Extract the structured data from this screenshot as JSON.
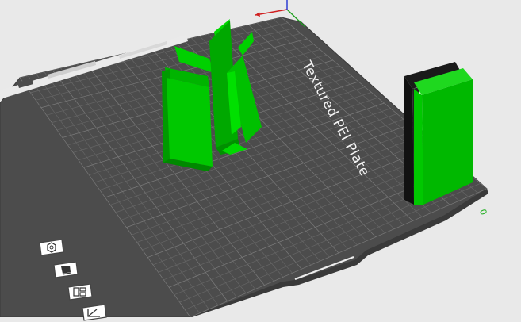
{
  "viewport": {
    "plate_label": "Textured PEI Plate",
    "origin_label": "0"
  },
  "colors": {
    "background": "#e9e9e9",
    "plate": "#4c4c4c",
    "grid": "#6a6a6a",
    "model_green": "#00c800",
    "model_green_dark": "#009a00",
    "model_black": "#1a1a1a",
    "axis_x": "#d02020",
    "axis_y": "#20a020",
    "axis_z": "#2030d0"
  },
  "toolbar_icons": [
    {
      "name": "nut-icon"
    },
    {
      "name": "bed-type-icon"
    },
    {
      "name": "layout-icon"
    },
    {
      "name": "measure-icon"
    }
  ]
}
